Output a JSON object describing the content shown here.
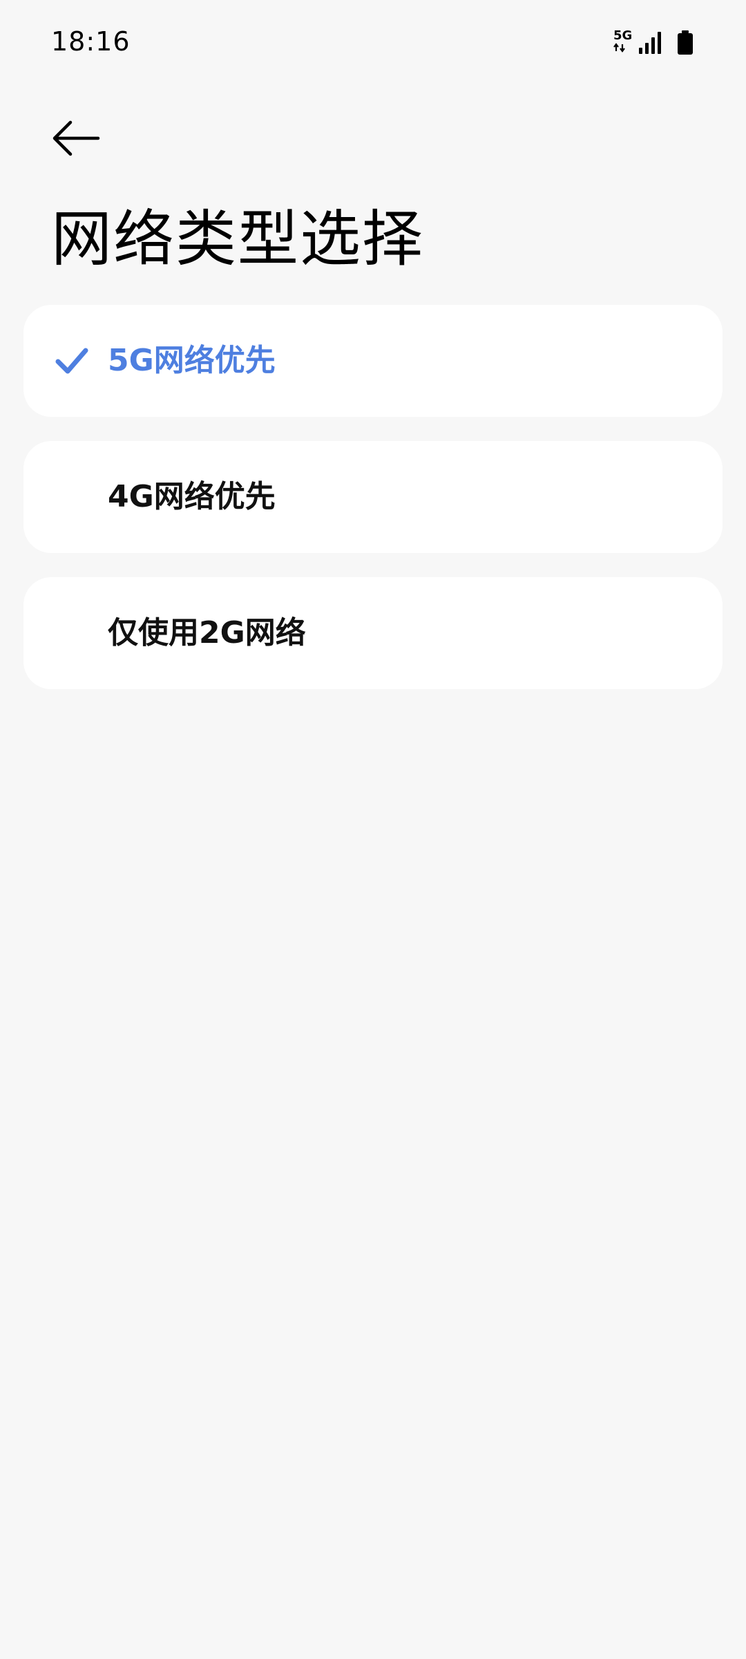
{
  "status_bar": {
    "time": "18:16",
    "network_type": "5G",
    "icons": [
      "5g-data-icon",
      "signal-strength-icon",
      "battery-icon"
    ]
  },
  "header": {
    "back_icon": "arrow-left-icon",
    "title": "网络类型选择"
  },
  "options": [
    {
      "label": "5G网络优先",
      "selected": true
    },
    {
      "label": "4G网络优先",
      "selected": false
    },
    {
      "label": "仅使用2G网络",
      "selected": false
    }
  ],
  "colors": {
    "accent": "#4e7fe0",
    "background": "#f7f7f7",
    "card": "#ffffff"
  }
}
